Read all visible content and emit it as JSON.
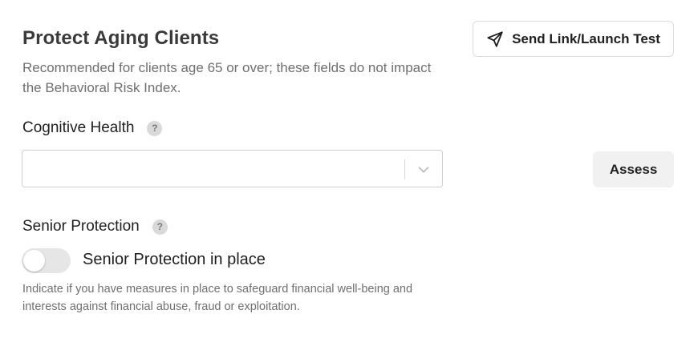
{
  "header": {
    "title": "Protect Aging Clients",
    "subtitle": "Recommended for clients age 65 or over; these fields do not impact the Behavioral Risk Index.",
    "send_button_label": "Send Link/Launch Test",
    "send_icon": "paper-plane-icon"
  },
  "cognitive_health": {
    "label": "Cognitive Health",
    "help_icon_text": "?",
    "select_value": "",
    "assess_label": "Assess"
  },
  "senior_protection": {
    "label": "Senior Protection",
    "help_icon_text": "?",
    "toggle_on": false,
    "toggle_label": "Senior Protection in place",
    "help_text": "Indicate if you have measures in place to safeguard financial well-being and interests against financial abuse, fraud or exploitation."
  },
  "colors": {
    "toggle_off": "#e6e6e6",
    "help_icon_bg": "#d9d9d9",
    "muted_text": "#6f6f6f",
    "assess_bg": "#f1f1f1"
  }
}
